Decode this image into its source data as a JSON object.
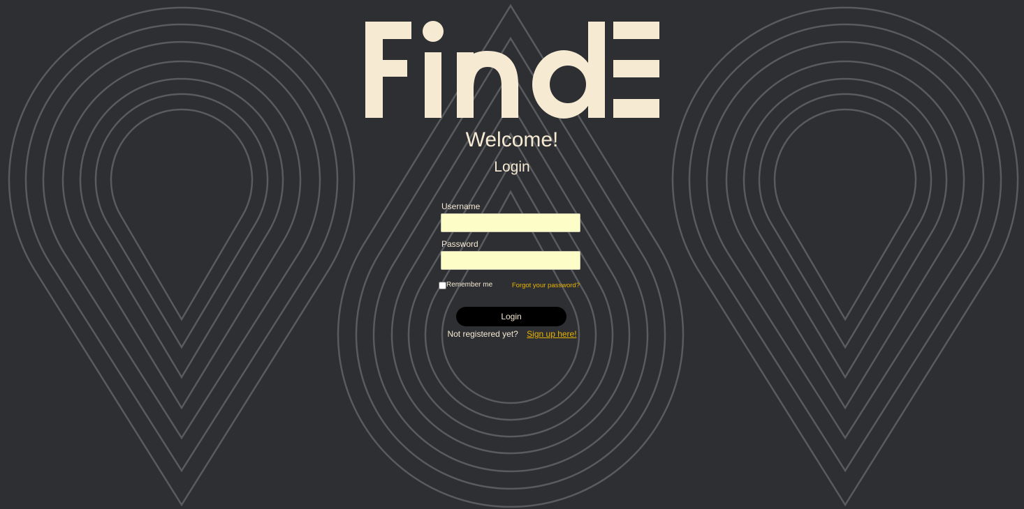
{
  "brand": {
    "logo_text": "FindE",
    "logo_color": "#f6ead3"
  },
  "colors": {
    "background": "#2e2f33",
    "pattern_stroke": "#5a5b5e",
    "accent": "#e8b400",
    "input_fill": "#fdfdc8",
    "button_fill": "#000000"
  },
  "header": {
    "welcome": "Welcome!",
    "subtitle": "Login"
  },
  "form": {
    "username_label": "Username",
    "username_value": "",
    "password_label": "Password",
    "password_value": "",
    "remember_label": "Remember me",
    "remember_checked": false,
    "forgot_link": "Forgot your password?",
    "submit_label": "Login"
  },
  "signup": {
    "prompt": "Not registered yet?",
    "link": "Sign up here!"
  },
  "background": {
    "pattern": "map-pin-contour-icon"
  }
}
